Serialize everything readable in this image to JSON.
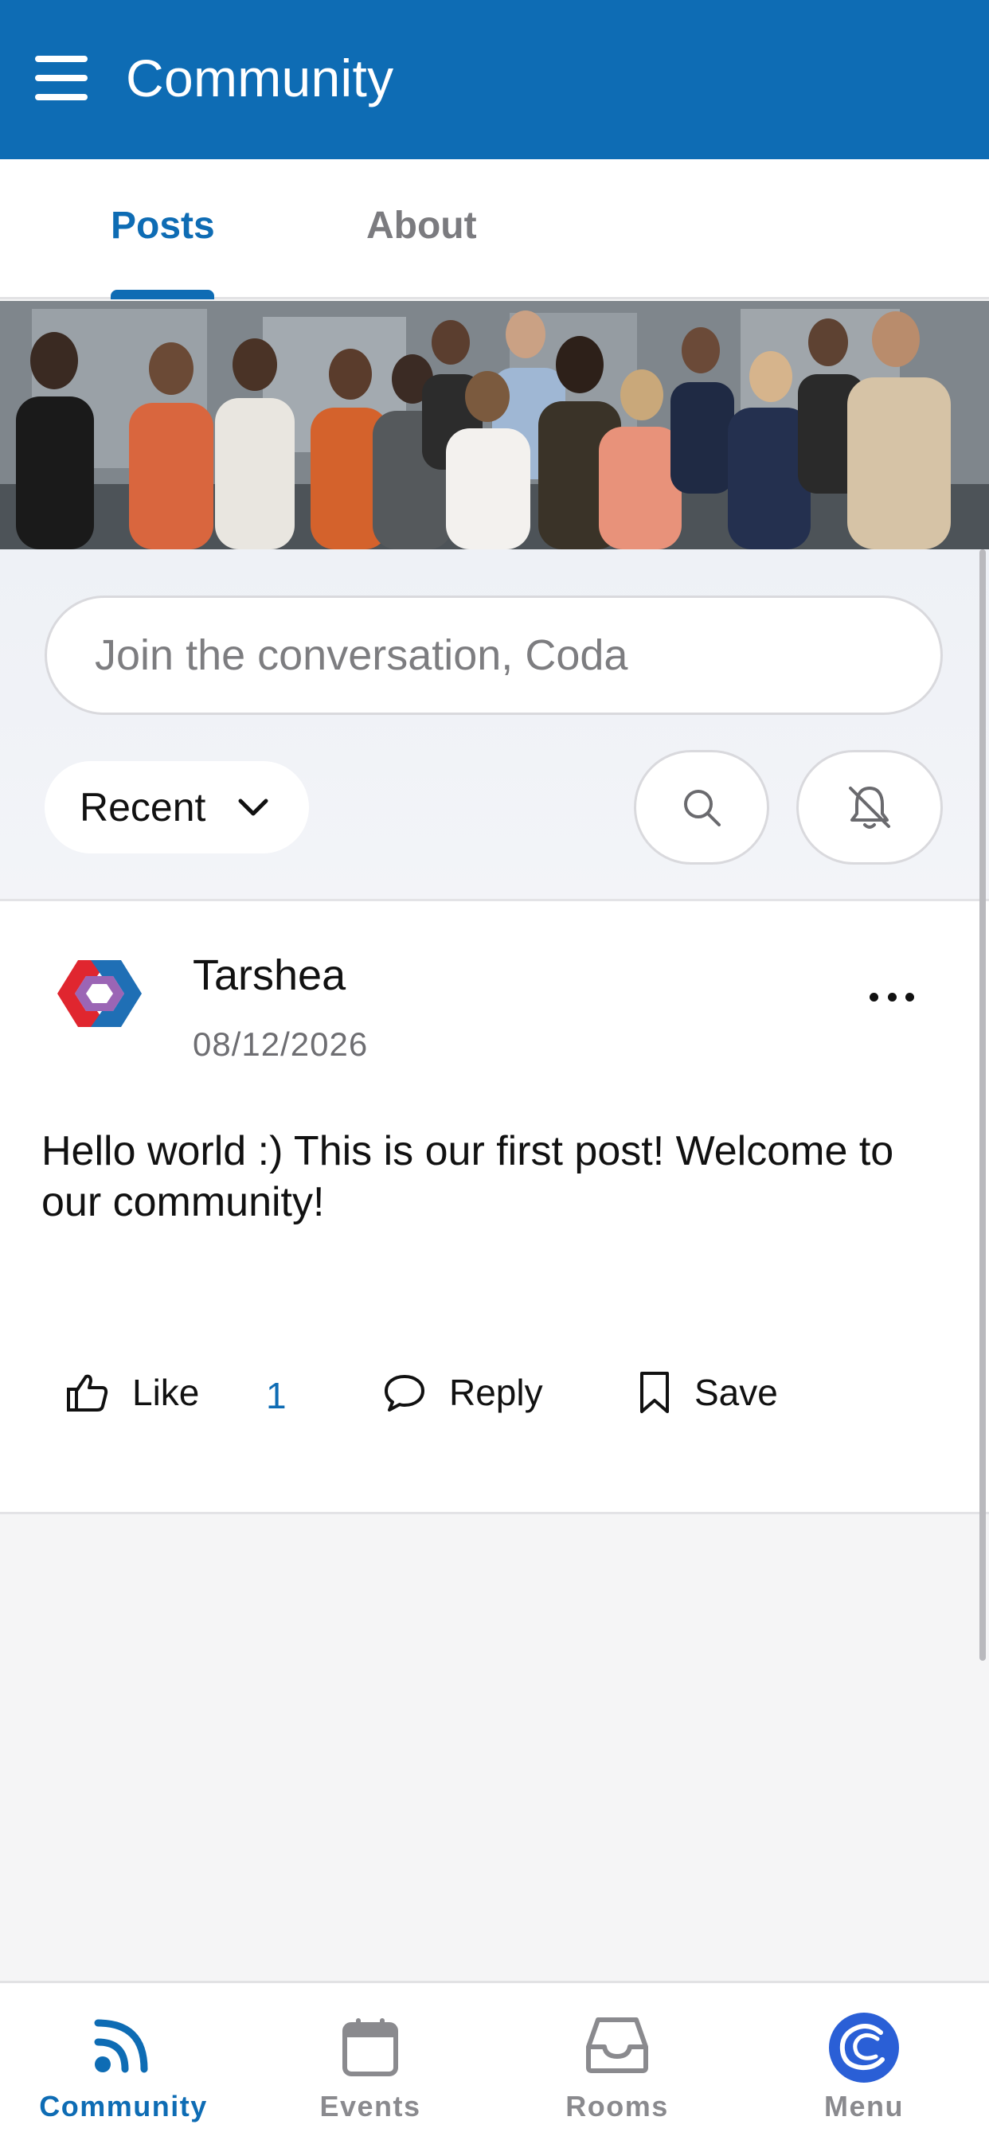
{
  "header": {
    "title": "Community"
  },
  "tabs": [
    {
      "label": "Posts",
      "active": true
    },
    {
      "label": "About",
      "active": false
    }
  ],
  "composer": {
    "placeholder": "Join the conversation, Coda"
  },
  "filters": {
    "sort_label": "Recent"
  },
  "post": {
    "author": "Tarshea",
    "date": "08/12/2026",
    "body": "Hello world :) This is our first post! Welcome to our community!",
    "actions": {
      "like_label": "Like",
      "like_count": "1",
      "reply_label": "Reply",
      "save_label": "Save"
    }
  },
  "bottom_nav": [
    {
      "label": "Community",
      "icon": "feed-icon",
      "active": true
    },
    {
      "label": "Events",
      "icon": "calendar-icon",
      "active": false
    },
    {
      "label": "Rooms",
      "icon": "inbox-icon",
      "active": false
    },
    {
      "label": "Menu",
      "icon": "app-logo-icon",
      "active": false
    }
  ],
  "colors": {
    "primary": "#0e6cb4",
    "inactive": "#8a8a8e",
    "background": "#f5f5f6"
  }
}
